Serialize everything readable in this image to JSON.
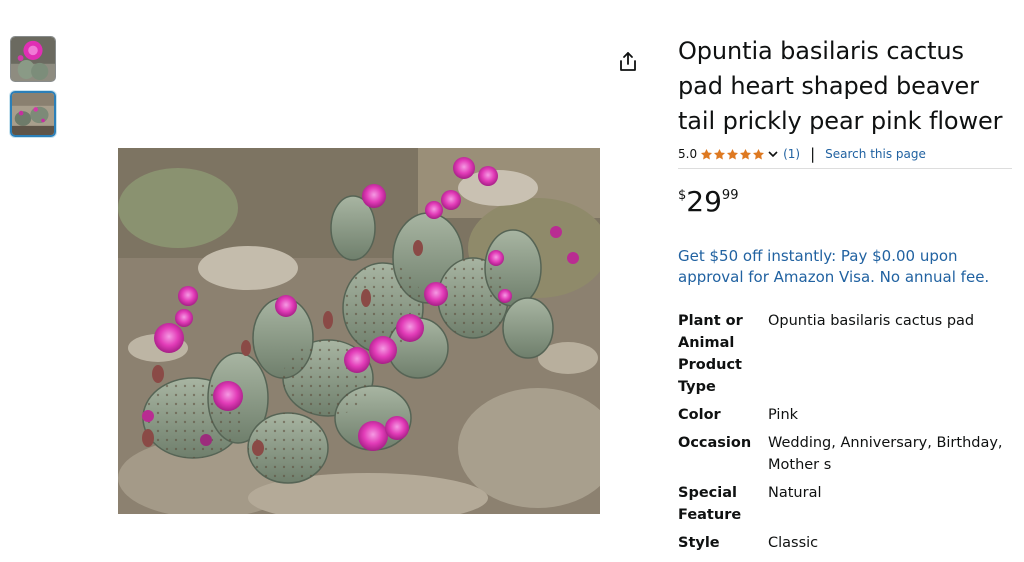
{
  "product": {
    "title": "Opuntia basilaris cactus pad heart shaped beaver tail prickly pear pink flower",
    "rating_value": "5.0",
    "rating_stars": 5,
    "review_count": "(1)",
    "separator": "|",
    "search_link": "Search this page"
  },
  "price": {
    "currency": "$",
    "whole": "29",
    "fraction": "99"
  },
  "promo": {
    "text": "Get $50 off instantly: Pay $0.00 upon approval for Amazon Visa. No annual fee."
  },
  "specs": [
    {
      "label": "Plant or Animal Product Type",
      "value": "Opuntia basilaris cactus pad"
    },
    {
      "label": "Color",
      "value": "Pink"
    },
    {
      "label": "Occasion",
      "value": "Wedding, Anniversary, Birthday, Mother s"
    },
    {
      "label": "Special Feature",
      "value": "Natural"
    },
    {
      "label": "Style",
      "value": "Classic"
    }
  ],
  "icons": {
    "share": "share-icon",
    "star": "star-icon",
    "chevron": "chevron-down-icon"
  },
  "colors": {
    "link": "#2162a1",
    "star": "#de7921",
    "text": "#0f1111",
    "flower": "#e23cb8",
    "cactus": "#8a9a86"
  }
}
